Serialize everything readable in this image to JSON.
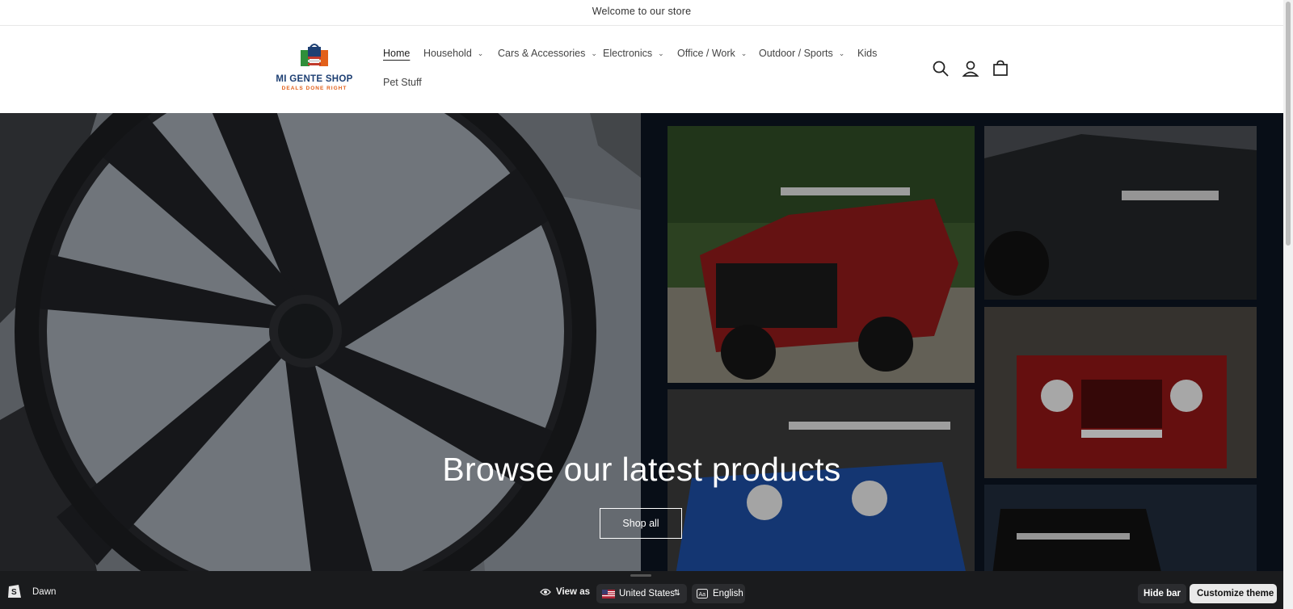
{
  "announcement": "Welcome to our store",
  "logo": {
    "name": "MI GENTE SHOP",
    "tagline": "DEALS DONE RIGHT"
  },
  "nav": [
    {
      "label": "Home",
      "active": true,
      "dropdown": false
    },
    {
      "label": "Household",
      "dropdown": true
    },
    {
      "label": "Cars & Accessories",
      "dropdown": true
    },
    {
      "label": "Electronics",
      "dropdown": true
    },
    {
      "label": "Office / Work",
      "dropdown": true
    },
    {
      "label": "Outdoor / Sports",
      "dropdown": true
    },
    {
      "label": "Kids",
      "dropdown": false
    },
    {
      "label": "Pet Stuff",
      "dropdown": false
    }
  ],
  "header_icons": [
    "search-icon",
    "account-icon",
    "cart-icon"
  ],
  "hero": {
    "title": "Browse our latest products",
    "button": "Shop all"
  },
  "bottom_bar": {
    "theme_name": "Dawn",
    "view_as": "View as",
    "country": "United States",
    "language": "English",
    "hide_bar": "Hide bar",
    "customize": "Customize theme"
  },
  "colors": {
    "brand_navy": "#1d3f73",
    "brand_orange": "#e2601a",
    "bar_bg": "#1a1b1d"
  }
}
